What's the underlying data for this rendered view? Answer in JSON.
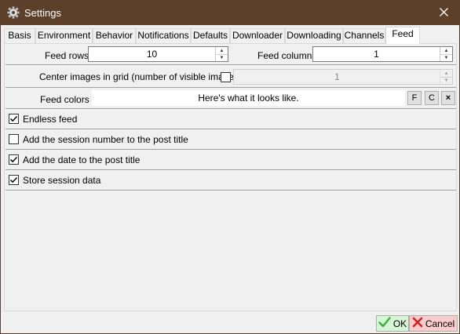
{
  "window": {
    "title": "Settings"
  },
  "tabs": [
    {
      "label": "Basis"
    },
    {
      "label": "Environment"
    },
    {
      "label": "Behavior"
    },
    {
      "label": "Notifications"
    },
    {
      "label": "Defaults"
    },
    {
      "label": "Downloader"
    },
    {
      "label": "Downloading"
    },
    {
      "label": "Channels"
    },
    {
      "label": "Feed",
      "active": true
    }
  ],
  "feed": {
    "rows_label": "Feed rows",
    "rows_value": "10",
    "columns_label": "Feed columns",
    "columns_value": "1",
    "center_label": "Center images in grid (number of visible images)",
    "center_checked": false,
    "center_value": "1",
    "colors_label": "Feed colors",
    "colors_preview": "Here's what it looks like.",
    "font_button": "F",
    "color_button": "C",
    "clear_button": "×"
  },
  "options": [
    {
      "label": "Endless feed",
      "checked": true
    },
    {
      "label": "Add the session number to the post title",
      "checked": false
    },
    {
      "label": "Add the date to the post title",
      "checked": true
    },
    {
      "label": "Store session data",
      "checked": true
    }
  ],
  "footer": {
    "ok_label": "OK",
    "cancel_label": "Cancel"
  },
  "icons": {
    "title": "gear-icon",
    "close": "close-icon",
    "ok": "checkmark-icon",
    "cancel": "cross-icon"
  },
  "colors": {
    "titlebar": "#5d4029",
    "ok_bg": "#d6f5d6",
    "cancel_bg": "#f8cccc"
  }
}
